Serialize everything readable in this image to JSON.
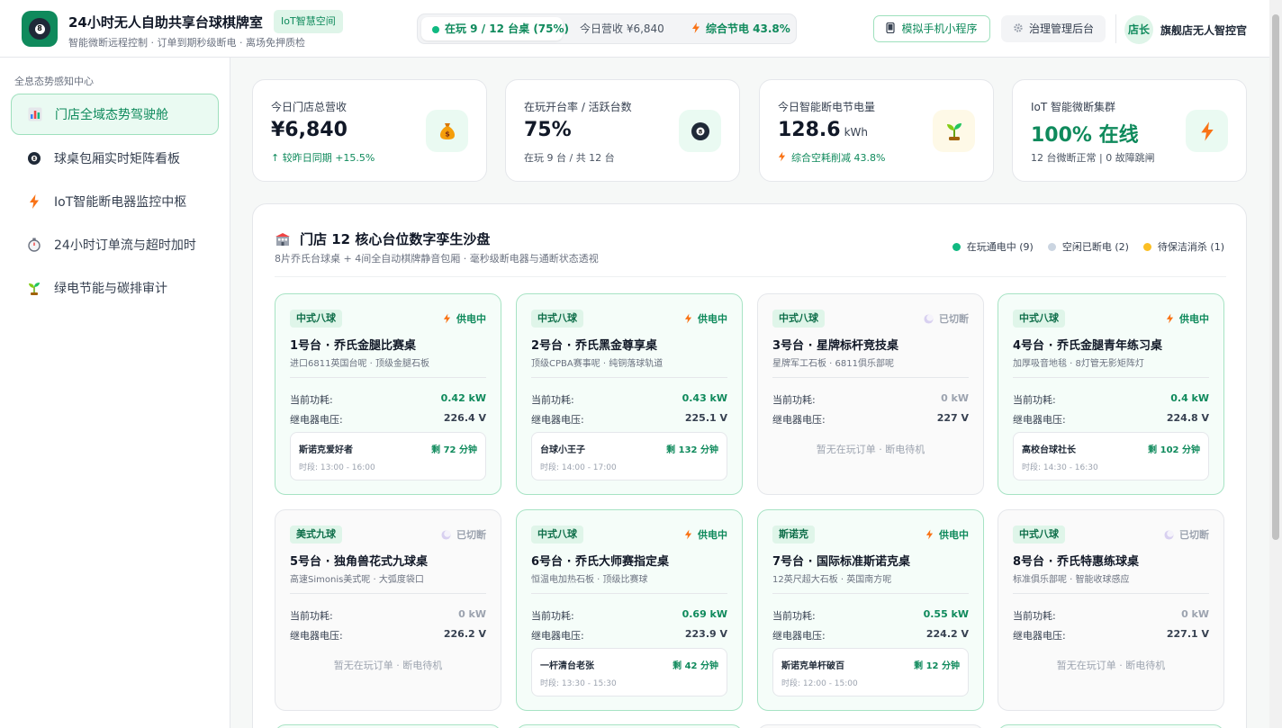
{
  "header": {
    "title": "24小时无人自助共享台球棋牌室",
    "badge": "IoT智慧空间",
    "subtitle": "智能微断远程控制 · 订单到期秒级断电 · 离场免押质检",
    "status_live": "在玩 9 / 12 台桌 (75%)",
    "status_revenue": "今日营收 ¥6,840",
    "status_saving": "综合节电 43.8%",
    "btn_mini_program": "模拟手机小程序",
    "btn_admin": "治理管理后台",
    "avatar_text": "店长",
    "user_name": "旗舰店无人智控官"
  },
  "sidebar": {
    "heading": "全息态势感知中心",
    "items": [
      {
        "label": "门店全域态势驾驶舱",
        "icon": "bar-chart-icon"
      },
      {
        "label": "球桌包厢实时矩阵看板",
        "icon": "billiard-ball-icon"
      },
      {
        "label": "IoT智能断电器监控中枢",
        "icon": "lightning-icon"
      },
      {
        "label": "24小时订单流与超时加时",
        "icon": "stopwatch-icon"
      },
      {
        "label": "绿电节能与碳排审计",
        "icon": "sprout-icon"
      }
    ]
  },
  "stats": [
    {
      "label": "今日门店总营收",
      "value": "¥6,840",
      "unit": "",
      "sub": "↑ 较昨日同期 +15.5%",
      "icon": "money-bag-icon"
    },
    {
      "label": "在玩开台率 / 活跃台数",
      "value": "75%",
      "unit": "",
      "sub": "在玩 9 台 / 共 12 台",
      "icon": "billiard-ball-icon"
    },
    {
      "label": "今日智能断电节电量",
      "value": "128.6",
      "unit": "kWh",
      "sub": "综合空耗削减 43.8%",
      "icon": "sprout-icon"
    },
    {
      "label": "IoT 智能微断集群",
      "value": "100% 在线",
      "unit": "",
      "sub": "12 台微断正常 | 0 故障跳闸",
      "icon": "lightning-icon"
    }
  ],
  "panel": {
    "title": "门店 12 核心台位数字孪生沙盘",
    "subtitle": "8片乔氏台球桌 + 4间全自动棋牌静音包厢 · 毫秒级断电器与通断状态透视",
    "legend": [
      {
        "label": "在玩通电中 (9)",
        "color": "#10b981"
      },
      {
        "label": "空闲已断电 (2)",
        "color": "#cbd5e1"
      },
      {
        "label": "待保洁消杀 (1)",
        "color": "#fbbf24"
      }
    ]
  },
  "labels": {
    "power": "当前功耗:",
    "voltage": "继电器电压:",
    "idle": "暂无在玩订单 · 断电待机",
    "on": "供电中",
    "off": "已切断"
  },
  "tables": [
    {
      "category": "中式八球",
      "state": "on",
      "state_label": "供电中",
      "name": "1号台 · 乔氏金腿比赛桌",
      "desc": "进口6811英国台呢 · 顶级金腿石板",
      "power": "0.42 kW",
      "voltage": "226.4 V",
      "order": {
        "user": "斯诺克爱好者",
        "remain": "剩 72 分钟",
        "time": "时段: 13:00 - 16:00"
      }
    },
    {
      "category": "中式八球",
      "state": "on",
      "state_label": "供电中",
      "name": "2号台 · 乔氏黑金尊享桌",
      "desc": "顶级CPBA赛事呢 · 纯铜落球轨道",
      "power": "0.43 kW",
      "voltage": "225.1 V",
      "order": {
        "user": "台球小王子",
        "remain": "剩 132 分钟",
        "time": "时段: 14:00 - 17:00"
      }
    },
    {
      "category": "中式八球",
      "state": "off",
      "state_label": "已切断",
      "name": "3号台 · 星牌标杆竞技桌",
      "desc": "星牌军工石板 · 6811俱乐部呢",
      "power": "0 kW",
      "voltage": "227 V",
      "order": null
    },
    {
      "category": "中式八球",
      "state": "on",
      "state_label": "供电中",
      "name": "4号台 · 乔氏金腿青年练习桌",
      "desc": "加厚吸音地毯 · 8灯管无影矩阵灯",
      "power": "0.4 kW",
      "voltage": "224.8 V",
      "order": {
        "user": "高校台球社长",
        "remain": "剩 102 分钟",
        "time": "时段: 14:30 - 16:30"
      }
    },
    {
      "category": "美式九球",
      "state": "off",
      "state_label": "已切断",
      "name": "5号台 · 独角兽花式九球桌",
      "desc": "高速Simonis美式呢 · 大弧度袋口",
      "power": "0 kW",
      "voltage": "226.2 V",
      "order": null
    },
    {
      "category": "中式八球",
      "state": "on",
      "state_label": "供电中",
      "name": "6号台 · 乔氏大师赛指定桌",
      "desc": "恒温电加热石板 · 顶级比赛球",
      "power": "0.69 kW",
      "voltage": "223.9 V",
      "order": {
        "user": "一杆清台老张",
        "remain": "剩 42 分钟",
        "time": "时段: 13:30 - 15:30"
      }
    },
    {
      "category": "斯诺克",
      "state": "on",
      "state_label": "供电中",
      "name": "7号台 · 国际标准斯诺克桌",
      "desc": "12英尺超大石板 · 英国南方呢",
      "power": "0.55 kW",
      "voltage": "224.2 V",
      "order": {
        "user": "斯诺克单杆破百",
        "remain": "剩 12 分钟",
        "time": "时段: 12:00 - 15:00"
      }
    },
    {
      "category": "中式八球",
      "state": "off",
      "state_label": "已切断",
      "name": "8号台 · 乔氏特惠练球桌",
      "desc": "标准俱乐部呢 · 智能收球感应",
      "power": "0 kW",
      "voltage": "227.1 V",
      "order": null
    }
  ]
}
